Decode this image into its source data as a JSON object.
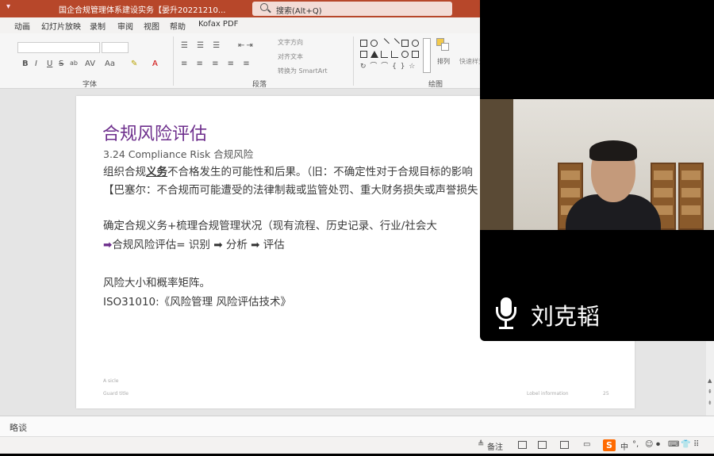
{
  "window": {
    "title": "国企合规管理体系建设实务【晏升20221210...",
    "quick_access": "▾",
    "search_placeholder": "搜索(Alt+Q)"
  },
  "menu": {
    "tabs": [
      "动画",
      "幻灯片放映",
      "录制",
      "审阅",
      "视图",
      "帮助",
      "Kofax PDF"
    ]
  },
  "ribbon": {
    "groups": {
      "font": "字体",
      "paragraph": "段落",
      "drawing": "绘图"
    },
    "paragraph_tools": {
      "text_direction": "文字方向",
      "align_text": "对齐文本",
      "smartart": "转换为 SmartArt"
    },
    "font_buttons": [
      "B",
      "I",
      "U",
      "S",
      "ab",
      "AV",
      "Aa",
      "A"
    ],
    "arrange": "排列",
    "quick_styles": "快速样式"
  },
  "slide": {
    "title": "合规风险评估",
    "line1": "3.24 Compliance Risk 合规风险",
    "line2_pre": "组织合规",
    "line2_bold": "义务",
    "line2_post": "不合格发生的可能性和后果。（旧：不确定性对于合规目标的影响",
    "line3": "【巴塞尔：不合规而可能遭受的法律制裁或监管处罚、重大财务损失或声誉损失",
    "line4": "确定合规义务+梳理合规管理状况（现有流程、历史记录、行业/社会大",
    "line5_arrow": "➡",
    "line5_a": "合规风险评估= 识别",
    "line5_b": "分析",
    "line5_c": "评估",
    "line5_sep": "➡",
    "line6": "风险大小和概率矩阵。",
    "line7": "ISO31010:《风险管理 风险评估技术》",
    "footer_left_top": "A sicle",
    "footer_left": "Guard title",
    "footer_right": "Lobel information",
    "page_num": "25"
  },
  "notes": {
    "placeholder": "略谈"
  },
  "status": {
    "notes_label": "备注",
    "ime": "中"
  },
  "video": {
    "speaker": "刘克韬"
  }
}
